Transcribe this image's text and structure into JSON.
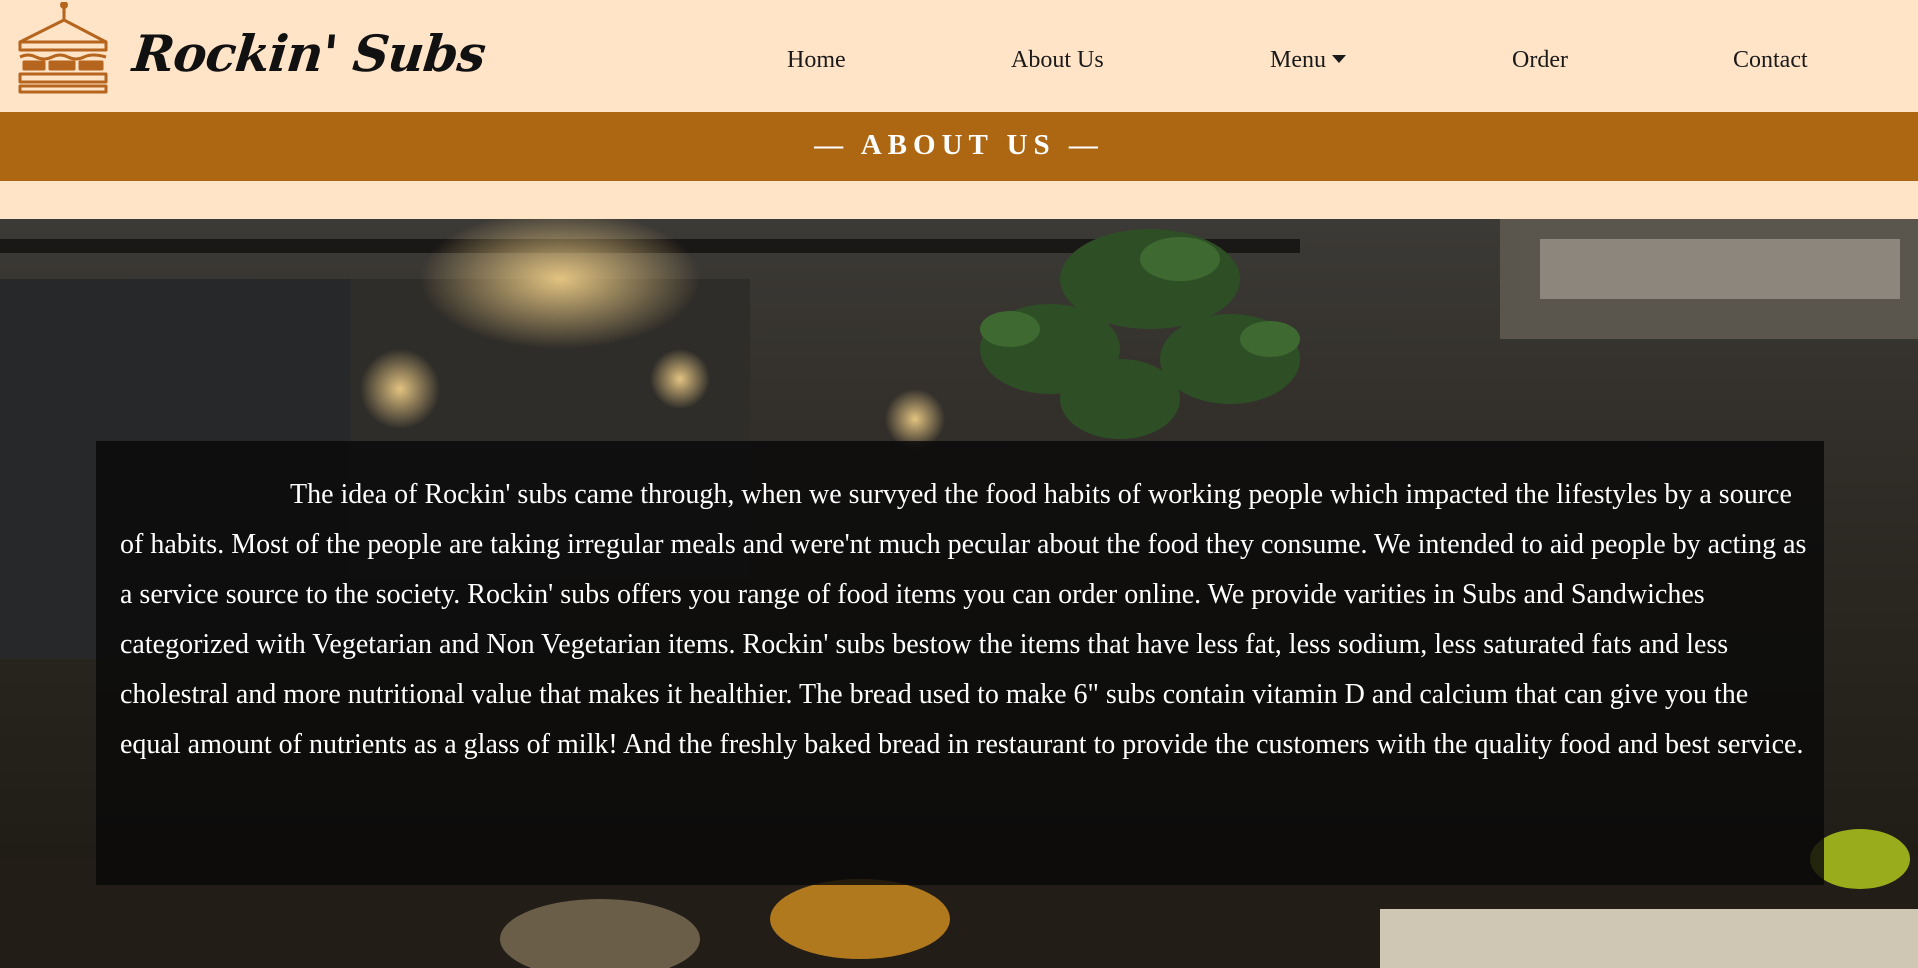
{
  "brand": {
    "name": "Rockin' Subs",
    "logo_icon": "sandwich-icon"
  },
  "nav": {
    "home": "Home",
    "about": "About Us",
    "menu": "Menu",
    "order": "Order",
    "contact": "Contact"
  },
  "banner": {
    "title": "— ABOUT US —"
  },
  "about": {
    "text": "The idea of Rockin' subs came through, when we survyed the food habits of working people which impacted the lifestyles by a source of habits. Most of the people are taking irregular meals and were'nt much pecular about the food they consume. We intended to aid people by acting as a service source to the society. Rockin' subs offers you range of food items you can order online. We provide varities in Subs and Sandwiches categorized with Vegetarian and Non Vegetarian items. Rockin' subs bestow the items that have less fat, less sodium, less saturated fats and less cholestral and more nutritional value that makes it healthier. The bread used to make 6\" subs contain vitamin D and calcium that can give you the equal amount of nutrients as a glass of milk! And the freshly baked bread in restaurant to provide the customers with the quality food and best service."
  },
  "colors": {
    "page_bg": "#ffe4c8",
    "banner_bg": "#ad6713",
    "logo_accent": "#b5651d",
    "overlay_bg": "#0a0a0a"
  }
}
